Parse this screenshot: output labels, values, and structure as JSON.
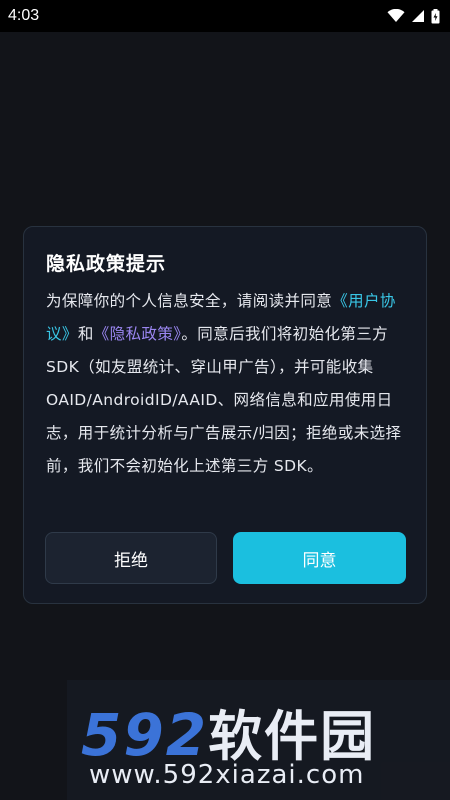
{
  "status_bar": {
    "time": "4:03"
  },
  "dialog": {
    "title": "隐私政策提示",
    "body": {
      "intro": "为保障你的个人信息安全，请阅读并同意",
      "user_agreement_link": "《用户协议》",
      "connector": "和",
      "privacy_policy_link": "《隐私政策》",
      "rest": "。同意后我们将初始化第三方 SDK（如友盟统计、穿山甲广告），并可能收集 OAID/AndroidID/AAID、网络信息和应用使用日志，用于统计分析与广告展示/归因；拒绝或未选择前，我们不会初始化上述第三方 SDK。"
    },
    "reject_label": "拒绝",
    "agree_label": "同意"
  },
  "watermark": {
    "logo_number": "592",
    "logo_text": "软件园",
    "url": "www.592xiazai.com"
  },
  "colors": {
    "accent": "#1bbfdf",
    "user_link": "#39c6e6",
    "privacy_link": "#9a86f0",
    "dialog_bg": "#141924"
  }
}
